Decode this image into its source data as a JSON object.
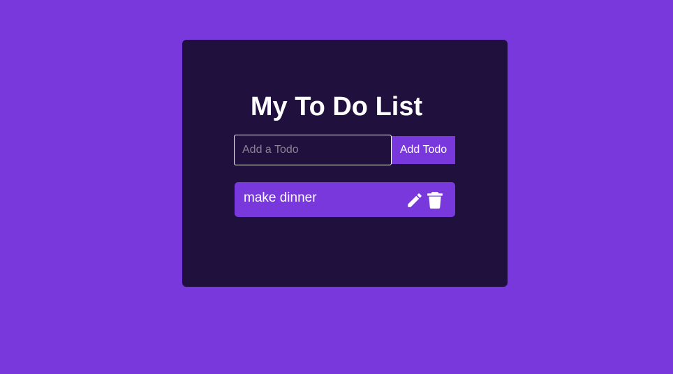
{
  "app": {
    "title": "My To Do List"
  },
  "add_form": {
    "input_value": "",
    "input_placeholder": "Add a Todo",
    "button_label": "Add Todo"
  },
  "todos": [
    {
      "text": "make dinner",
      "edit_icon": "pencil-icon",
      "delete_icon": "trash-icon"
    }
  ],
  "colors": {
    "background": "#7838db",
    "card": "#1f103d",
    "accent": "#7838db",
    "text": "#ffffff"
  }
}
